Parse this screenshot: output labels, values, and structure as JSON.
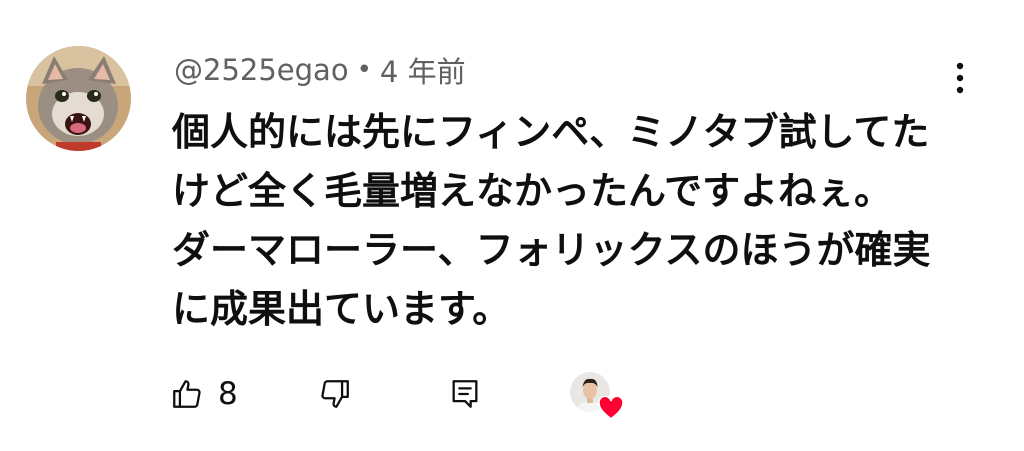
{
  "comment": {
    "author_handle": "@2525egao",
    "separator": "•",
    "posted_ago": "4 年前",
    "text_lines": [
      "個人的には先にフィンペ、ミノタブ試してた",
      "けど全く毛量増えなかったんですよねぇ。",
      "ダーマローラー、フォリックスのほうが確実",
      "に成果出ています。"
    ]
  },
  "actions": {
    "like_count": "8"
  },
  "icons": {
    "menu": "more-vert-icon",
    "like": "thumbs-up-icon",
    "dislike": "thumbs-down-icon",
    "reply": "comment-icon",
    "creator_heart": "heart-icon"
  },
  "colors": {
    "meta_text": "#606060",
    "body_text": "#0f0f0f",
    "heart": "#ff0033"
  }
}
